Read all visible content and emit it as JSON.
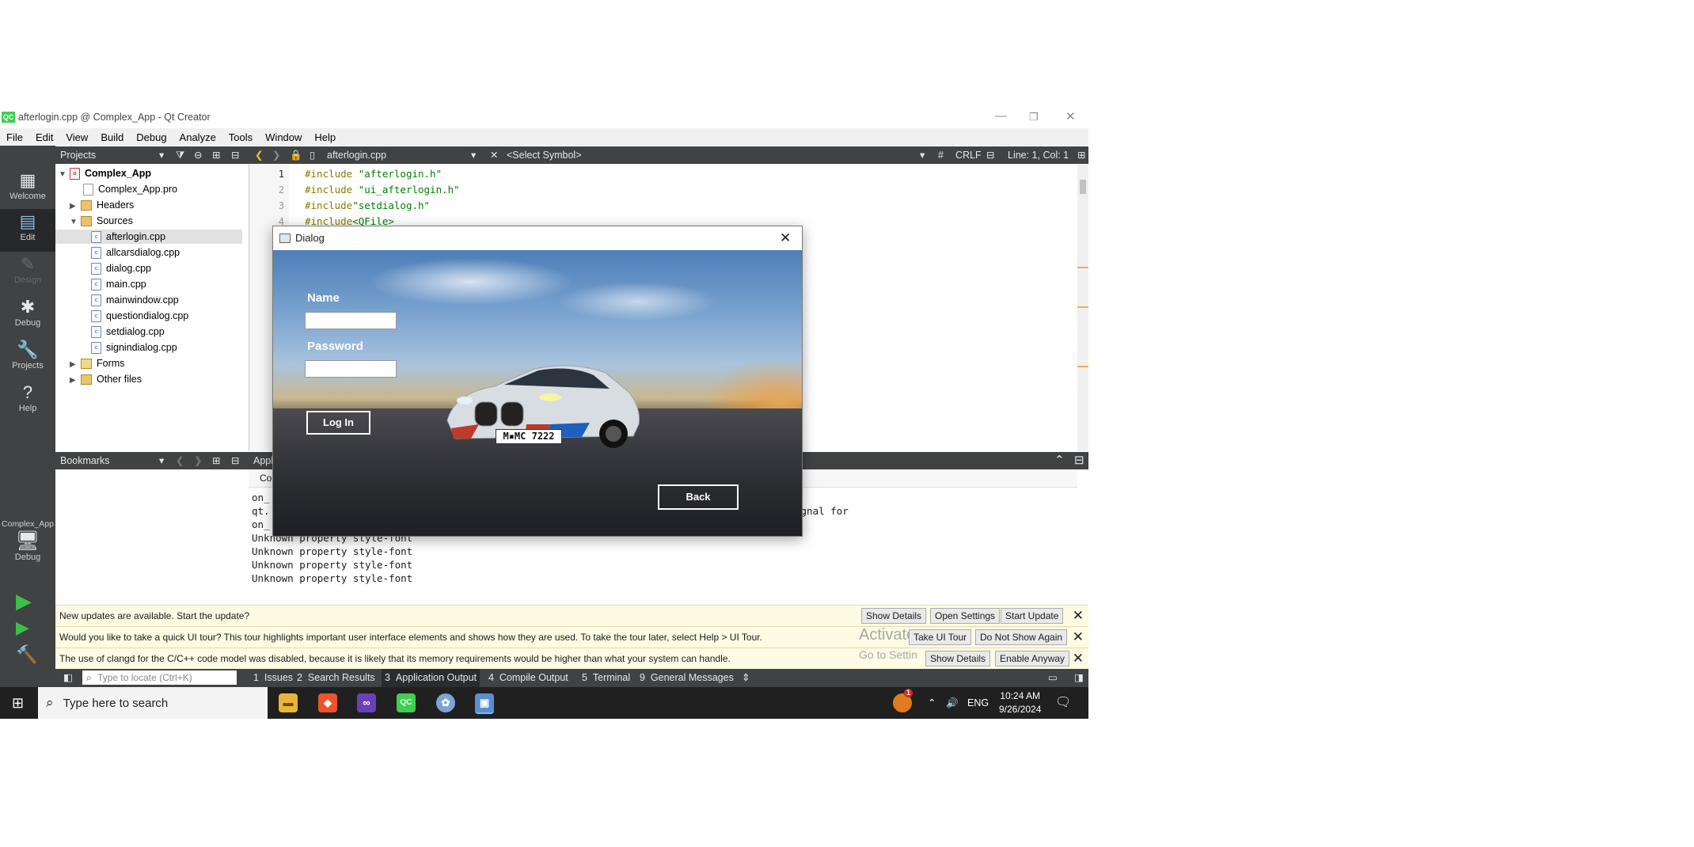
{
  "window": {
    "title": "afterlogin.cpp @ Complex_App - Qt Creator",
    "logo": "QC"
  },
  "menu": [
    "File",
    "Edit",
    "View",
    "Build",
    "Debug",
    "Analyze",
    "Tools",
    "Window",
    "Help"
  ],
  "modes": [
    {
      "label": "Welcome",
      "icon": "grid-icon"
    },
    {
      "label": "Edit",
      "icon": "edit-icon"
    },
    {
      "label": "Design",
      "icon": "pen-icon"
    },
    {
      "label": "Debug",
      "icon": "bug-icon"
    },
    {
      "label": "Projects",
      "icon": "wrench-icon"
    },
    {
      "label": "Help",
      "icon": "help-icon"
    }
  ],
  "kit": {
    "project": "Complex_App",
    "config": "Debug"
  },
  "projects": {
    "header": "Projects",
    "root": "Complex_App",
    "pro": "Complex_App.pro",
    "headers": "Headers",
    "sources": "Sources",
    "files": [
      "afterlogin.cpp",
      "allcarsdialog.cpp",
      "dialog.cpp",
      "main.cpp",
      "mainwindow.cpp",
      "questiondialog.cpp",
      "setdialog.cpp",
      "signindialog.cpp"
    ],
    "forms": "Forms",
    "other": "Other files"
  },
  "editor": {
    "file": "afterlogin.cpp",
    "symbol": "<Select Symbol>",
    "hash": "#",
    "eol": "CRLF",
    "position": "Line: 1, Col: 1",
    "lines": [
      {
        "n": "1",
        "a": "#include ",
        "b": "\"afterlogin.h\""
      },
      {
        "n": "2",
        "a": "#include ",
        "b": "\"ui_afterlogin.h\""
      },
      {
        "n": "3",
        "a": "#include",
        "b": "\"setdialog.h\""
      },
      {
        "n": "4",
        "a": "#include",
        "b": "<QFile>"
      }
    ]
  },
  "bookmarks": {
    "header": "Bookmarks"
  },
  "output": {
    "header": "Appl",
    "subtab": "Co",
    "lines": [
      "on_",
      "qt.",
      "on_",
      "Unknown property style-font",
      "Unknown property style-font",
      "Unknown property style-font",
      "Unknown property style-font"
    ],
    "tail": "ignal for"
  },
  "infobars": [
    {
      "msg": "New updates are available. Start the update?",
      "buttons": [
        "Show Details",
        "Open Settings",
        "Start Update"
      ]
    },
    {
      "msg": "Would you like to take a quick UI tour? This tour highlights important user interface elements and shows how they are used. To take the tour later, select Help > UI Tour.",
      "buttons": [
        "Take UI Tour",
        "Do Not Show Again"
      ]
    },
    {
      "msg": "The use of clangd for the C/C++ code model was disabled, because it is likely that its memory requirements would be higher than what your system can handle.",
      "buttons": [
        "Show Details",
        "Enable Anyway"
      ]
    }
  ],
  "watermark": {
    "line1": "Activate",
    "line2": "Go to Settin"
  },
  "statusbar": {
    "locate_placeholder": "Type to locate (Ctrl+K)",
    "tabs": [
      {
        "n": "1",
        "label": "Issues"
      },
      {
        "n": "2",
        "label": "Search Results"
      },
      {
        "n": "3",
        "label": "Application Output"
      },
      {
        "n": "4",
        "label": "Compile Output"
      },
      {
        "n": "5",
        "label": "Terminal"
      },
      {
        "n": "9",
        "label": "General Messages"
      }
    ]
  },
  "taskbar": {
    "search": "Type here to search",
    "lang": "ENG",
    "time": "10:24 AM",
    "date": "9/26/2024",
    "notif_badge": "1"
  },
  "dialog": {
    "title": "Dialog",
    "name_label": "Name",
    "password_label": "Password",
    "login": "Log In",
    "back": "Back",
    "plate": "M▪MC 7222",
    "name_value": "",
    "password_value": ""
  },
  "colors": {
    "sidebar": "#404244",
    "infobar": "#fdfbe3",
    "qt_green": "#41cd52",
    "taskbar": "#202020"
  }
}
